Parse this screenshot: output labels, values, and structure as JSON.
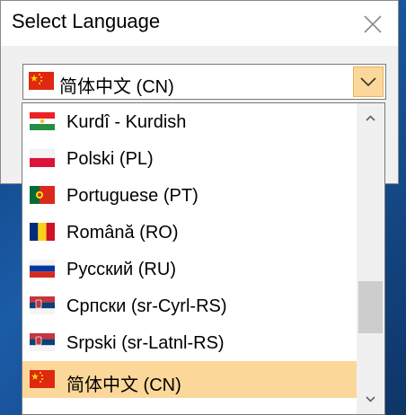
{
  "dialog": {
    "title": "Select Language",
    "close_icon": "close-icon"
  },
  "combo": {
    "selected": "简体中文 (CN)",
    "flag": "flag-cn-icon",
    "arrow_icon": "chevron-down-icon"
  },
  "dropdown": {
    "items": [
      {
        "label": "Kurdî - Kurdish",
        "flag": "flag-kurdistan-icon"
      },
      {
        "label": "Polski (PL)",
        "flag": "flag-pl-icon"
      },
      {
        "label": "Portuguese (PT)",
        "flag": "flag-pt-icon"
      },
      {
        "label": "Română (RO)",
        "flag": "flag-ro-icon"
      },
      {
        "label": "Русский (RU)",
        "flag": "flag-ru-icon"
      },
      {
        "label": "Српски (sr-Cyrl-RS)",
        "flag": "flag-rs-icon"
      },
      {
        "label": "Srpski (sr-Latnl-RS)",
        "flag": "flag-rs-icon"
      },
      {
        "label": "简体中文 (CN)",
        "flag": "flag-cn-icon",
        "selected": true
      }
    ],
    "highlight_color": "#fcd79a"
  }
}
